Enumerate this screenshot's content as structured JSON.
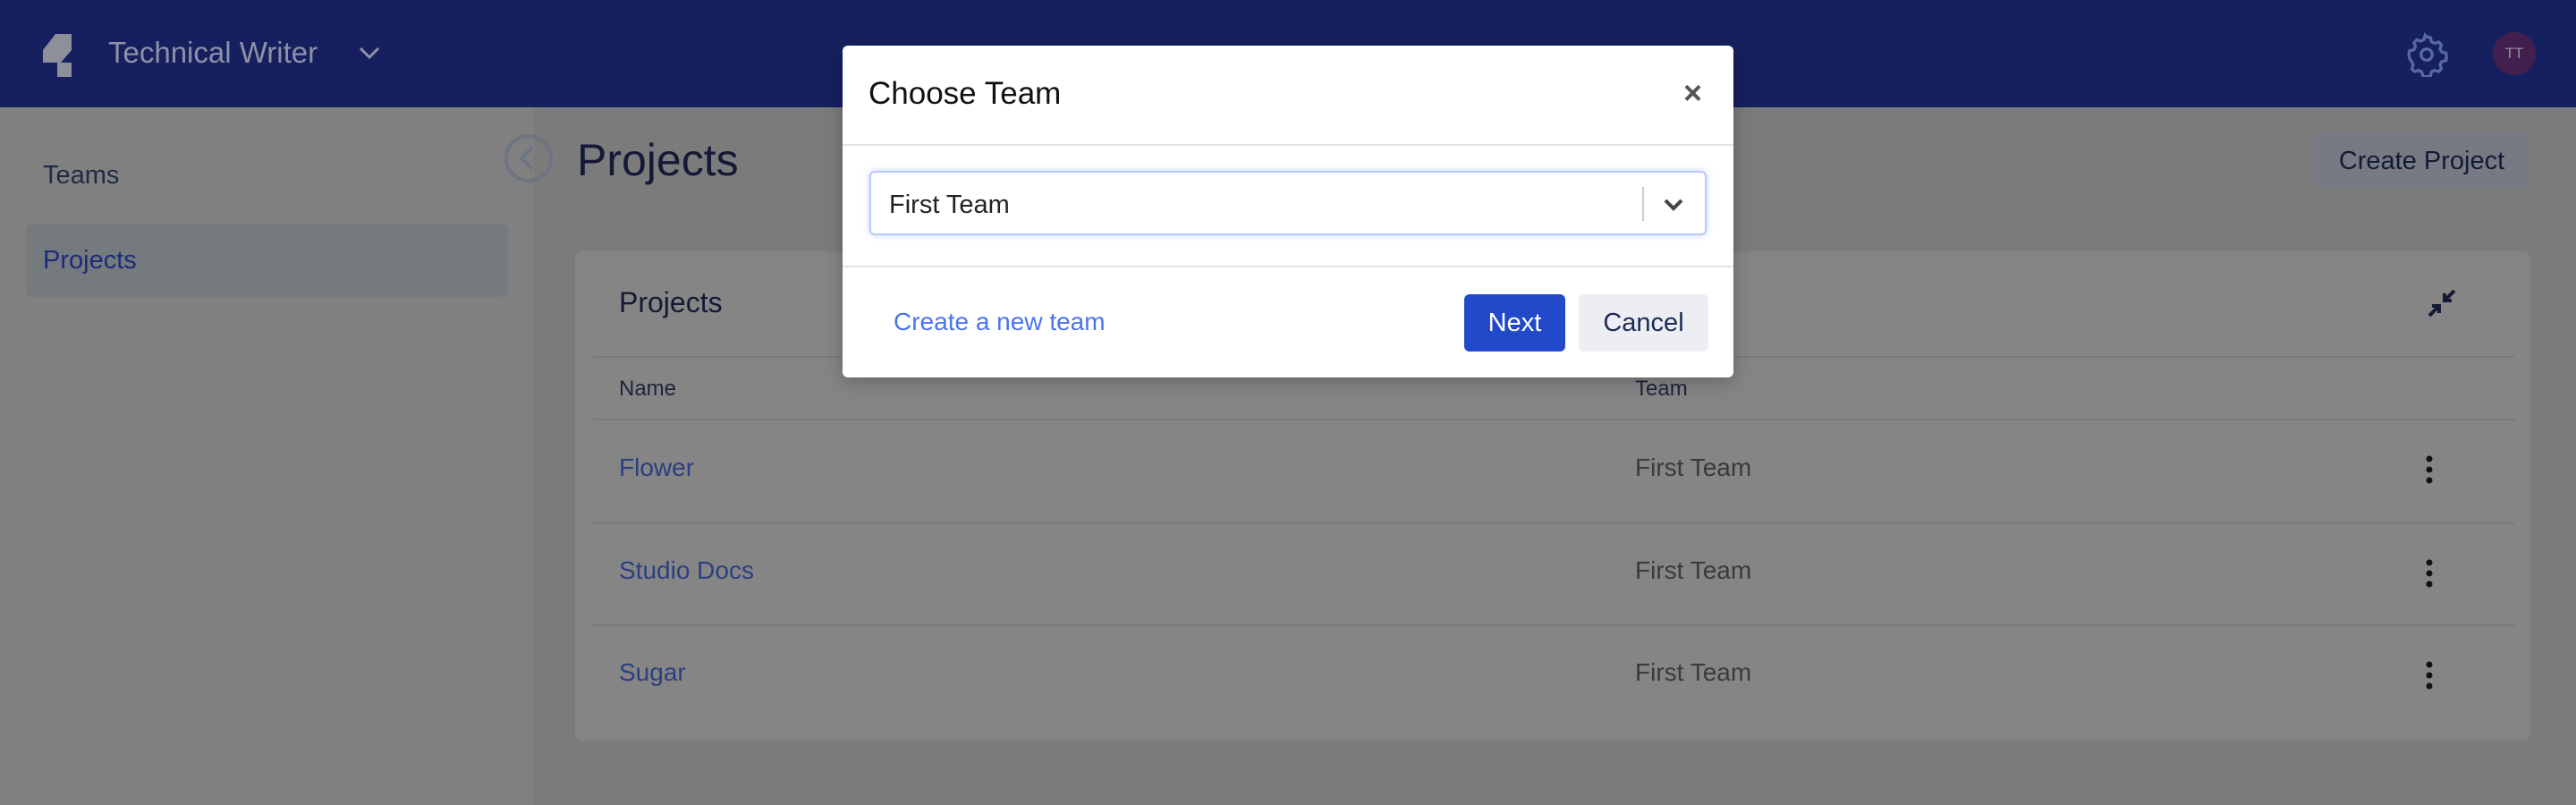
{
  "header": {
    "app_title": "Technical Writer",
    "avatar_initials": "TT",
    "brand_color": "#16205e"
  },
  "sidebar": {
    "items": [
      {
        "label": "Teams"
      },
      {
        "label": "Projects",
        "active": true
      }
    ]
  },
  "main": {
    "title": "Projects",
    "create_button": "Create Project",
    "card": {
      "title": "Projects",
      "columns": [
        "Name",
        "Team"
      ],
      "rows": [
        {
          "name": "Flower",
          "team": "First Team"
        },
        {
          "name": "Studio Docs",
          "team": "First Team"
        },
        {
          "name": "Sugar",
          "team": "First Team"
        }
      ]
    }
  },
  "modal": {
    "title": "Choose Team",
    "close": "×",
    "select_value": "First Team",
    "create_link": "Create a new team",
    "next": "Next",
    "cancel": "Cancel",
    "primary_color": "#2249c9"
  }
}
